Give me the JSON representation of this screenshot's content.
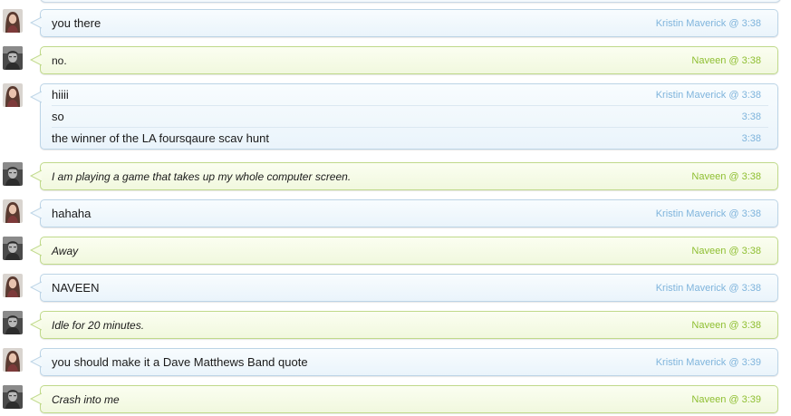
{
  "participants": {
    "kristin": {
      "name": "Kristin Maverick",
      "avatar_icon": "woman-portrait-avatar",
      "accent": "#7fb4dc",
      "bubble_bg": "#eef6fc",
      "bubble_border": "#bcd4e6"
    },
    "naveen": {
      "name": "Naveen",
      "avatar_icon": "man-portrait-avatar",
      "accent": "#8fbf32",
      "bubble_bg": "#f4fae4",
      "bubble_border": "#bfd98a"
    }
  },
  "messages": [
    {
      "sender": "kristin",
      "lines": [
        {
          "text": "you there",
          "meta": "Kristin Maverick @ 3:38"
        }
      ]
    },
    {
      "sender": "naveen",
      "lines": [
        {
          "text": "no.",
          "meta": "Naveen @ 3:38"
        }
      ]
    },
    {
      "sender": "kristin",
      "lines": [
        {
          "text": "hiiii",
          "meta": "Kristin Maverick @ 3:38"
        },
        {
          "text": "so",
          "meta": "3:38"
        },
        {
          "text": "the winner of the LA foursqaure scav hunt",
          "meta": "3:38"
        }
      ]
    },
    {
      "sender": "naveen",
      "lines": [
        {
          "text": "I am playing a game that takes up my whole computer screen.",
          "meta": "Naveen @ 3:38",
          "italic": true
        }
      ]
    },
    {
      "sender": "kristin",
      "lines": [
        {
          "text": "hahaha",
          "meta": "Kristin Maverick @ 3:38"
        }
      ]
    },
    {
      "sender": "naveen",
      "lines": [
        {
          "text": "Away",
          "meta": "Naveen @ 3:38",
          "italic": true
        }
      ]
    },
    {
      "sender": "kristin",
      "lines": [
        {
          "text": "NAVEEN",
          "meta": "Kristin Maverick @ 3:38"
        }
      ]
    },
    {
      "sender": "naveen",
      "lines": [
        {
          "text": "Idle for 20 minutes.",
          "meta": "Naveen @ 3:38",
          "italic": true
        }
      ]
    },
    {
      "sender": "kristin",
      "lines": [
        {
          "text": "you should make it a Dave Matthews Band quote",
          "meta": "Kristin Maverick @ 3:39"
        }
      ]
    },
    {
      "sender": "naveen",
      "lines": [
        {
          "text": "Crash into me",
          "meta": "Naveen @ 3:39",
          "italic": true
        }
      ]
    }
  ]
}
